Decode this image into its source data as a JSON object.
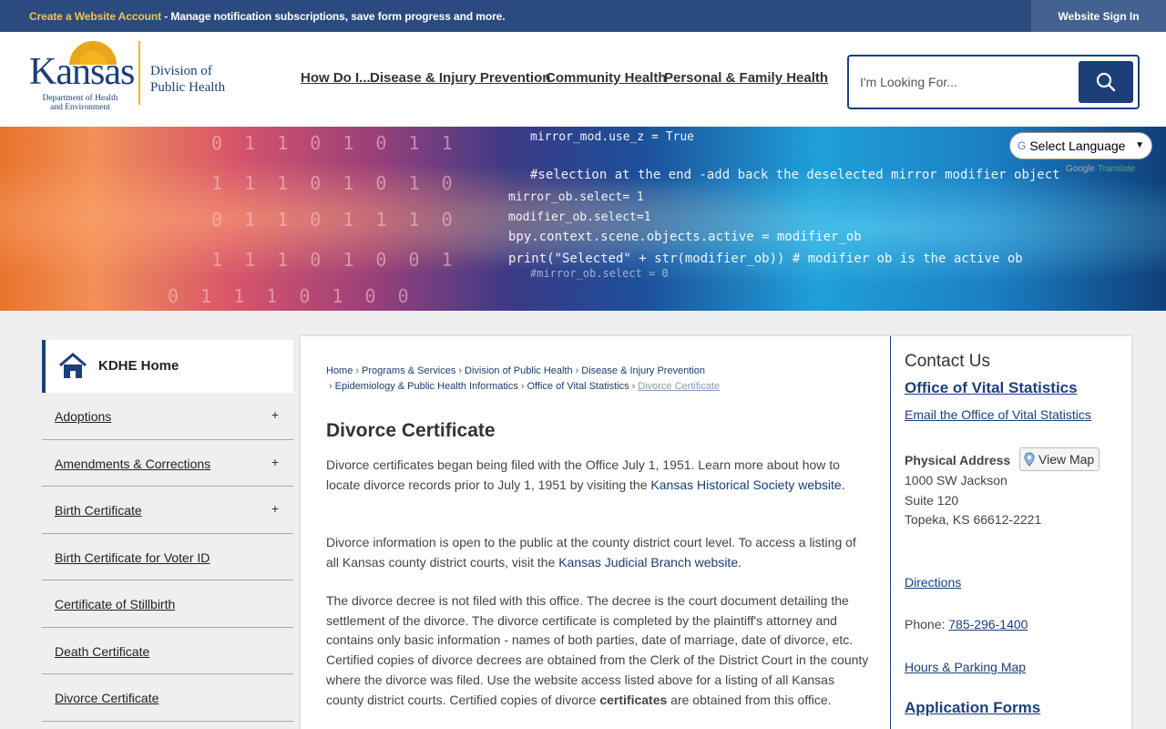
{
  "topbar": {
    "create_link": "Create a Website Account",
    "message": " - Manage notification subscriptions, save form progress and more.",
    "signin": "Website Sign In"
  },
  "logo": {
    "name": "Kansas",
    "dept_line1": "Department of Health",
    "dept_line2": "and Environment",
    "division_line1": "Division of",
    "division_line2": "Public Health"
  },
  "nav": [
    "How Do I...",
    "Disease & Injury Prevention",
    "Community Health",
    "Personal & Family Health"
  ],
  "search": {
    "placeholder": "I'm Looking For..."
  },
  "banner": {
    "code_lines": [
      "mirror_mod.use_z = True",
      "#selection at the end -add back the deselected mirror modifier object",
      "mirror_ob.select= 1",
      "modifier_ob.select=1",
      "bpy.context.scene.objects.active = modifier_ob",
      "print(\"Selected\" + str(modifier_ob)) # modifier ob is the active ob",
      "#mirror_ob.select = 0"
    ],
    "binary_lines": [
      "0 1 1 0 1 0 1 1",
      "1 1 1 0 1 0 1 0",
      "0 1 1 0 1 1 1 0",
      "1 1 1 0 1 0 0 1",
      "0 1 1 1 0 1 0 0"
    ]
  },
  "translate": {
    "select_label": "Select Language",
    "powered_google": "Google",
    "powered_translate": "Translate"
  },
  "leftnav": {
    "home": "KDHE Home",
    "items": [
      {
        "label": "Adoptions",
        "expand": "+"
      },
      {
        "label": "Amendments & Corrections",
        "expand": "+"
      },
      {
        "label": "Birth Certificate",
        "expand": "+"
      },
      {
        "label": "Birth Certificate for Voter ID",
        "expand": ""
      },
      {
        "label": "Certificate of Stillbirth",
        "expand": ""
      },
      {
        "label": "Death Certificate",
        "expand": ""
      },
      {
        "label": "Divorce Certificate",
        "expand": ""
      }
    ]
  },
  "breadcrumb": [
    "Home",
    "Programs & Services",
    "Division of Public Health",
    "Disease & Injury Prevention",
    "Epidemiology & Public Health Informatics",
    "Office of Vital Statistics",
    "Divorce Certificate"
  ],
  "page": {
    "title": "Divorce Certificate",
    "p1_a": "Divorce certificates began being filed with the Office July 1, 1951. Learn more about how to locate divorce records prior to July 1, 1951 by visiting the ",
    "p1_link": "Kansas Historical Society website",
    "p1_b": ".",
    "p2_a": "Divorce information is open to the public at the county district court level. To access a listing of all Kansas county district courts, visit the ",
    "p2_link": "Kansas Judicial Branch website",
    "p2_b": ".",
    "p3_a": "The divorce decree is not filed with this office. The decree is the court document detailing the settlement of the divorce. The divorce certificate is completed by the plaintiff's attorney and contains only basic information - names of both parties, date of marriage, date of divorce, etc. Certified copies of divorce decrees are obtained from the Clerk of the District Court in the county where the divorce was filed. Use the website access listed above for a listing of all Kansas county district courts. Certified copies of divorce ",
    "p3_bold": "certificates",
    "p3_b": " are obtained from this office."
  },
  "contact": {
    "heading": "Contact Us",
    "office": "Office of Vital Statistics",
    "email": "Email the Office of Vital Statistics",
    "address_label": "Physical Address",
    "view_map": "View Map",
    "address1": "1000 SW Jackson",
    "address2": "Suite 120",
    "address3": "Topeka, KS 66612-2221",
    "directions": "Directions",
    "phone_label": "Phone: ",
    "phone": "785-296-1400",
    "hours": "Hours & Parking Map",
    "forms": "Application Forms"
  }
}
